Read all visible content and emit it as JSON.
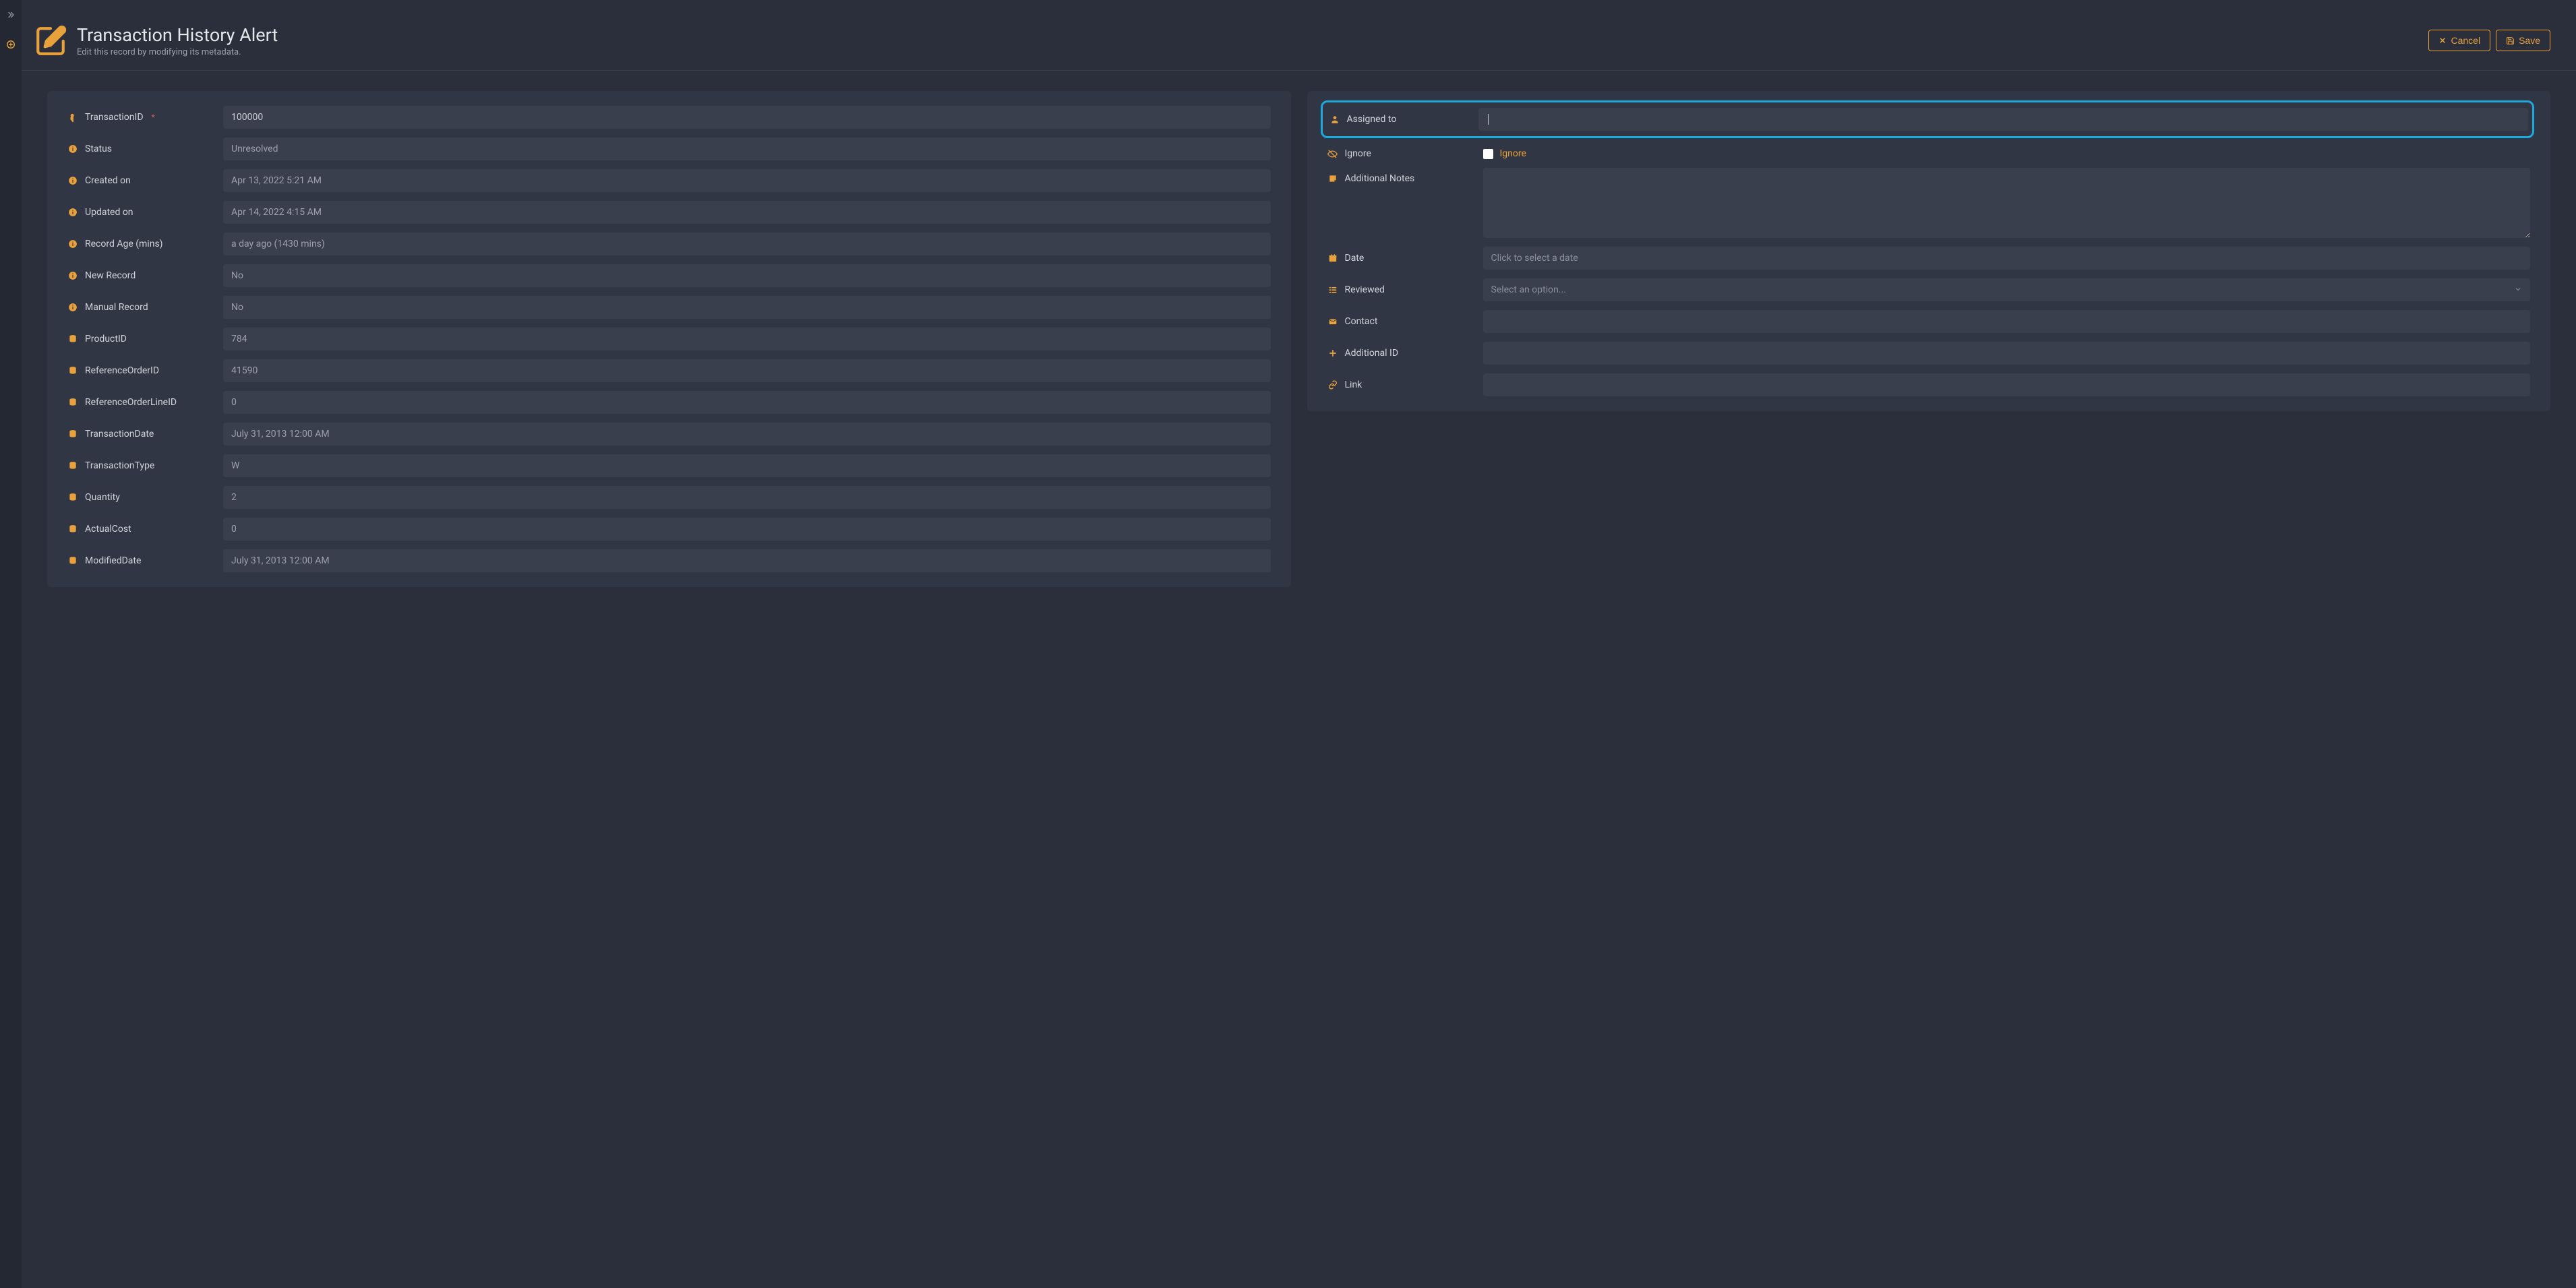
{
  "accent": "#e9a13b",
  "header": {
    "title": "Transaction History Alert",
    "subtitle": "Edit this record by modifying its metadata.",
    "cancel_label": "Cancel",
    "save_label": "Save"
  },
  "left_fields": {
    "transaction_id": {
      "label": "TransactionID",
      "value": "100000",
      "required": true
    },
    "status": {
      "label": "Status",
      "value": "Unresolved"
    },
    "created_on": {
      "label": "Created on",
      "value": "Apr 13, 2022 5:21 AM"
    },
    "updated_on": {
      "label": "Updated on",
      "value": "Apr 14, 2022 4:15 AM"
    },
    "record_age": {
      "label": "Record Age (mins)",
      "value": "a day ago (1430 mins)"
    },
    "new_record": {
      "label": "New Record",
      "value": "No"
    },
    "manual_record": {
      "label": "Manual Record",
      "value": "No"
    },
    "product_id": {
      "label": "ProductID",
      "value": "784"
    },
    "ref_order_id": {
      "label": "ReferenceOrderID",
      "value": "41590"
    },
    "ref_order_line": {
      "label": "ReferenceOrderLineID",
      "value": "0"
    },
    "txn_date": {
      "label": "TransactionDate",
      "value": "July 31, 2013 12:00 AM"
    },
    "txn_type": {
      "label": "TransactionType",
      "value": "W"
    },
    "quantity": {
      "label": "Quantity",
      "value": "2"
    },
    "actual_cost": {
      "label": "ActualCost",
      "value": "0"
    },
    "modified_date": {
      "label": "ModifiedDate",
      "value": "July 31, 2013 12:00 AM"
    }
  },
  "right_fields": {
    "assigned_to": {
      "label": "Assigned to",
      "value": ""
    },
    "ignore": {
      "label": "Ignore",
      "check_label": "Ignore",
      "checked": false
    },
    "notes": {
      "label": "Additional Notes",
      "value": ""
    },
    "date": {
      "label": "Date",
      "placeholder": "Click to select a date",
      "value": ""
    },
    "reviewed": {
      "label": "Reviewed",
      "placeholder": "Select an option...",
      "value": ""
    },
    "contact": {
      "label": "Contact",
      "value": ""
    },
    "additional_id": {
      "label": "Additional ID",
      "value": ""
    },
    "link": {
      "label": "Link",
      "value": ""
    }
  }
}
